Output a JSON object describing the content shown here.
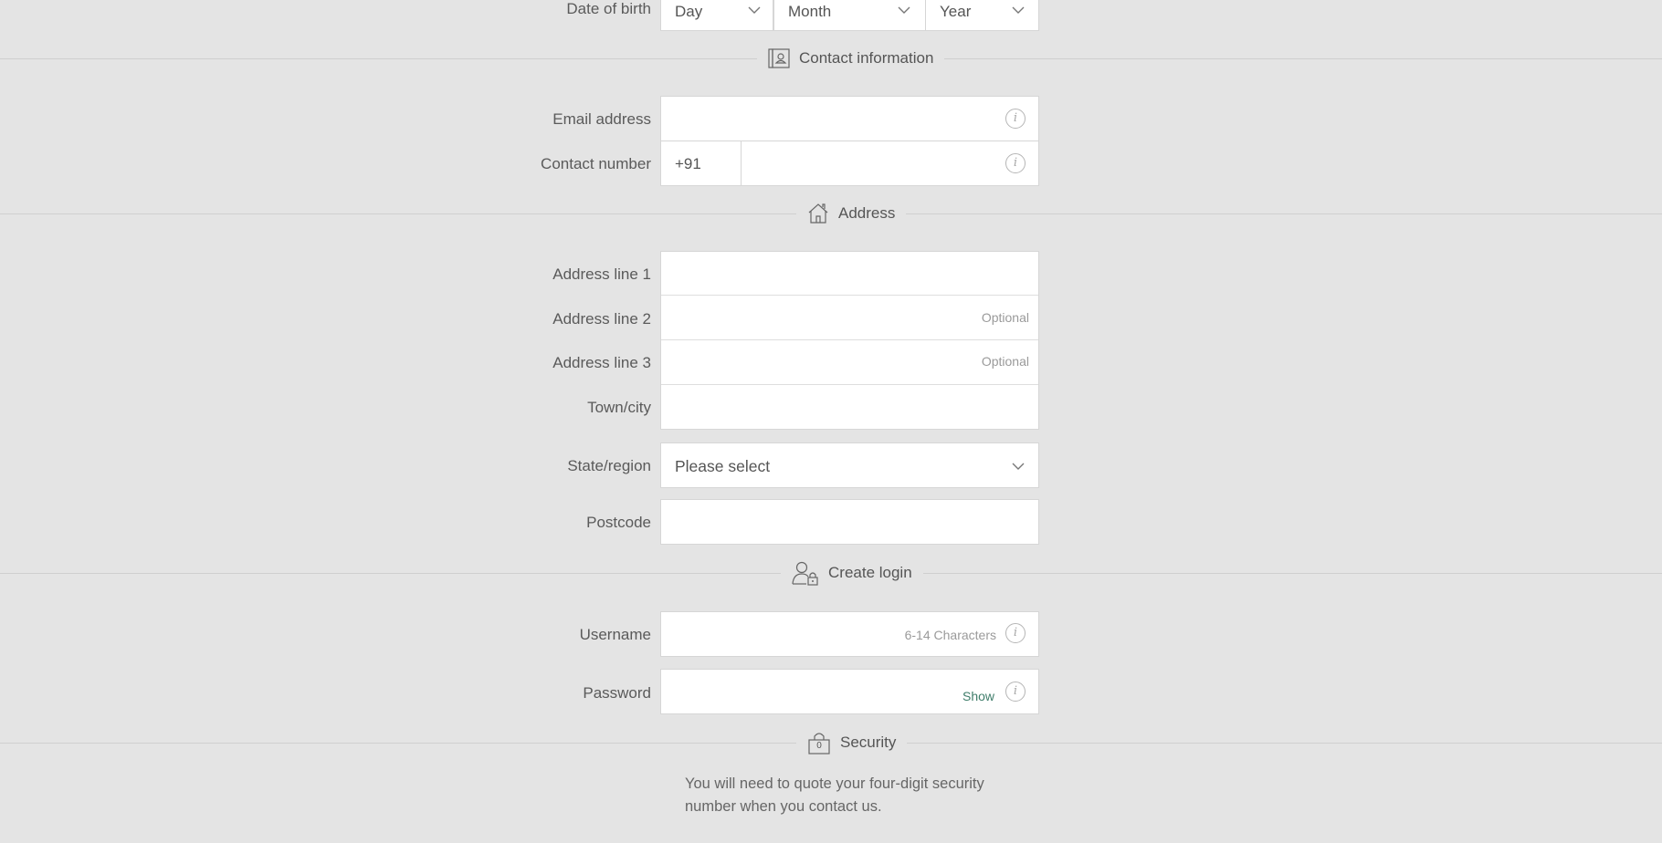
{
  "dob": {
    "label": "Date of birth",
    "day": "Day",
    "month": "Month",
    "year": "Year"
  },
  "contact": {
    "heading": "Contact information",
    "email_label": "Email address",
    "phone_label": "Contact number",
    "phone_prefix": "+91",
    "info_glyph": "i"
  },
  "address": {
    "heading": "Address",
    "line1_label": "Address line 1",
    "line2_label": "Address line 2",
    "line2_hint": "Optional",
    "line3_label": "Address line 3",
    "line3_hint": "Optional",
    "town_label": "Town/city",
    "state_label": "State/region",
    "state_value": "Please select",
    "postcode_label": "Postcode"
  },
  "login": {
    "heading": "Create login",
    "username_label": "Username",
    "username_hint": "6-14 Characters",
    "password_label": "Password",
    "show_label": "Show"
  },
  "security": {
    "heading": "Security",
    "lock_digit": "0",
    "note": "You will need to quote your four-digit security number when you contact us."
  },
  "icons": {
    "contact": "contact-card-icon",
    "address": "house-icon",
    "login": "user-lock-icon",
    "security": "padlock-icon",
    "info": "info-icon",
    "chevron": "chevron-down-icon"
  },
  "colors": {
    "background": "#e4e4e4",
    "field": "#ffffff",
    "link": "#3f7d6a"
  }
}
